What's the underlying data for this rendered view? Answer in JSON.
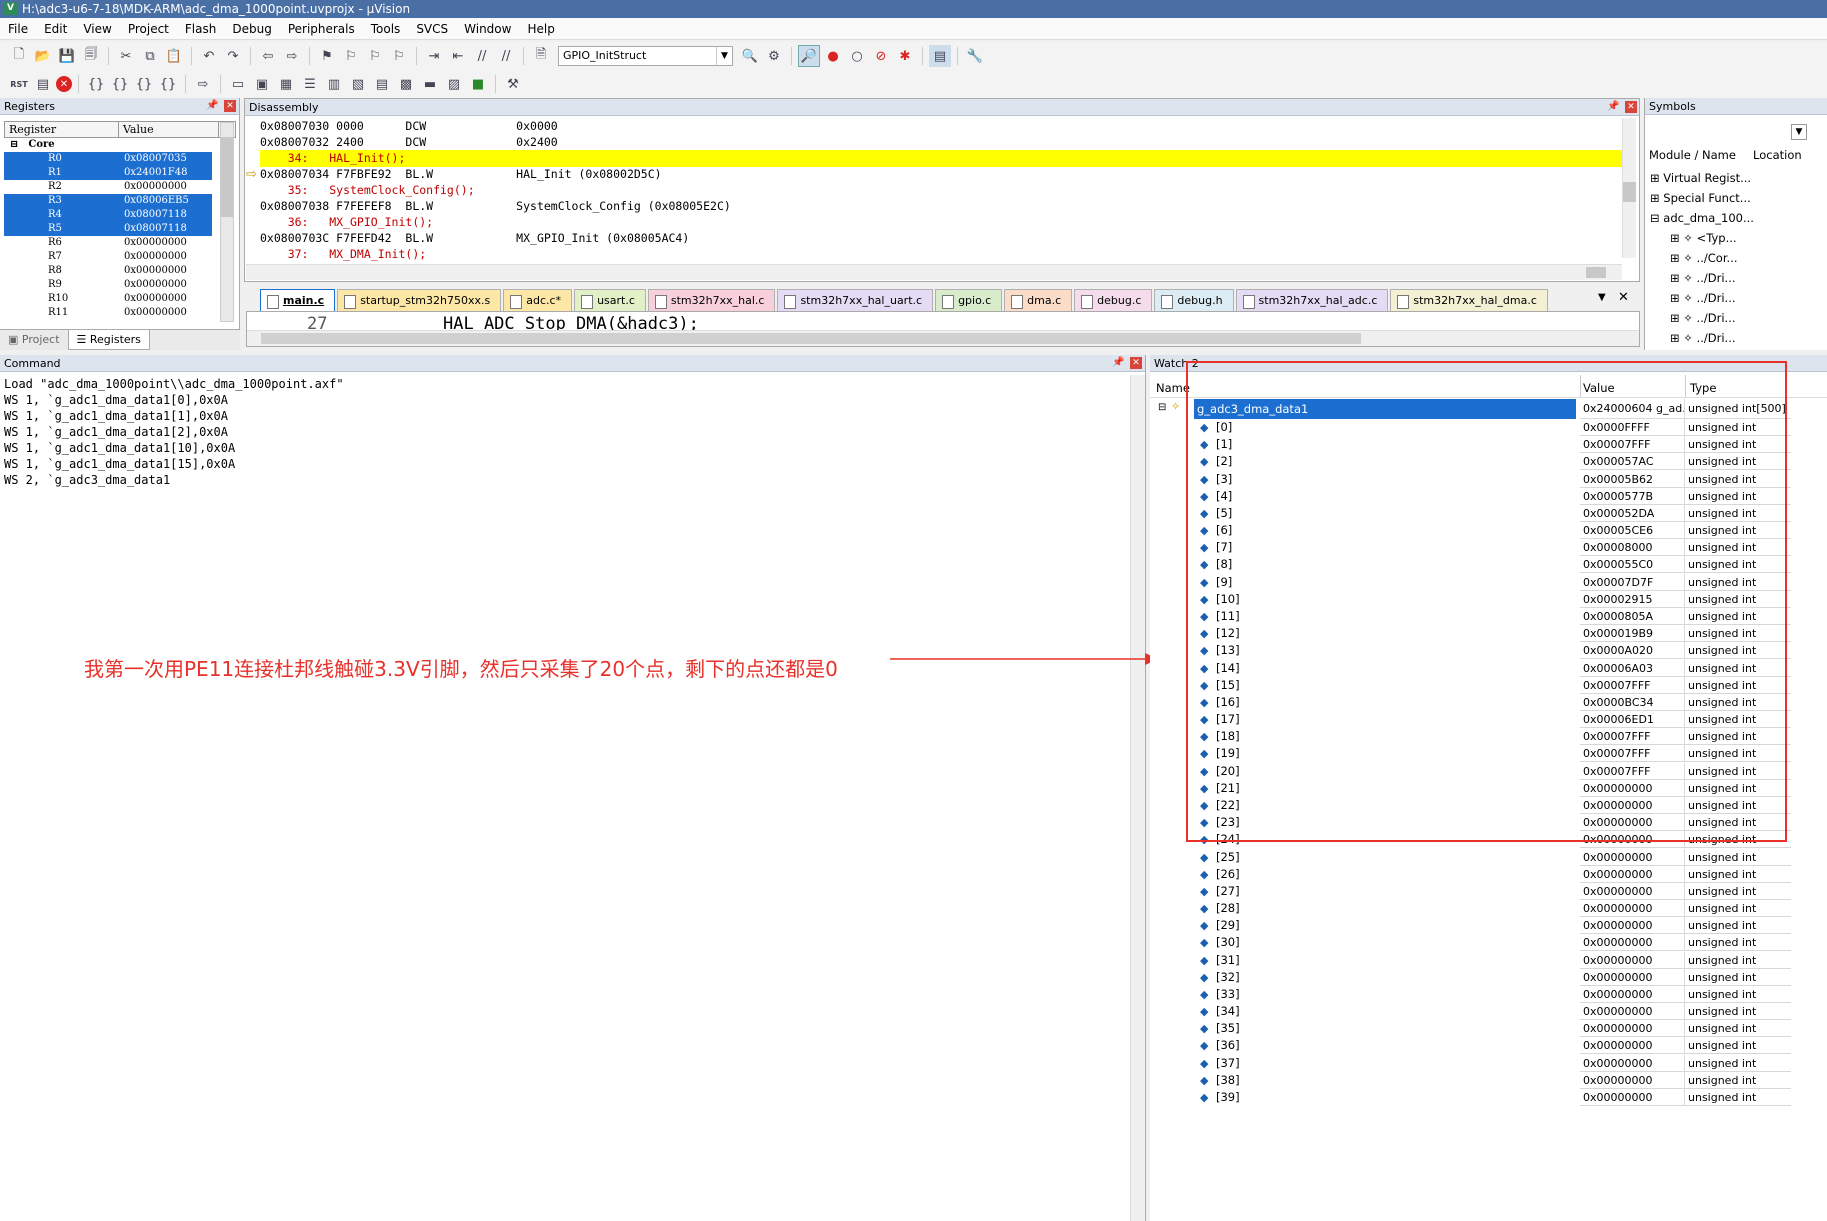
{
  "window": {
    "title": "H:\\adc3-u6-7-18\\MDK-ARM\\adc_dma_1000point.uvprojx - µVision",
    "logo": "V"
  },
  "menu": [
    "File",
    "Edit",
    "View",
    "Project",
    "Flash",
    "Debug",
    "Peripherals",
    "Tools",
    "SVCS",
    "Window",
    "Help"
  ],
  "toolbar": {
    "combo_value": "GPIO_InitStruct",
    "reset_label": "RST"
  },
  "registers": {
    "title": "Registers",
    "col_register": "Register",
    "col_value": "Value",
    "group": "Core",
    "rows": [
      {
        "name": "R0",
        "value": "0x08007035",
        "selected": true
      },
      {
        "name": "R1",
        "value": "0x24001F48",
        "selected": true
      },
      {
        "name": "R2",
        "value": "0x00000000",
        "selected": false
      },
      {
        "name": "R3",
        "value": "0x08006EB5",
        "selected": true
      },
      {
        "name": "R4",
        "value": "0x08007118",
        "selected": true
      },
      {
        "name": "R5",
        "value": "0x08007118",
        "selected": true
      },
      {
        "name": "R6",
        "value": "0x00000000",
        "selected": false
      },
      {
        "name": "R7",
        "value": "0x00000000",
        "selected": false
      },
      {
        "name": "R8",
        "value": "0x00000000",
        "selected": false
      },
      {
        "name": "R9",
        "value": "0x00000000",
        "selected": false
      },
      {
        "name": "R10",
        "value": "0x00000000",
        "selected": false
      },
      {
        "name": "R11",
        "value": "0x00000000",
        "selected": false
      }
    ],
    "tab_project": "Project",
    "tab_registers": "Registers"
  },
  "disassembly": {
    "title": "Disassembly",
    "lines": [
      {
        "text": "0x08007030 0000      DCW             0x0000",
        "kind": "asm"
      },
      {
        "text": "0x08007032 2400      DCW             0x2400",
        "kind": "asm"
      },
      {
        "text": "    34:   HAL_Init();",
        "kind": "src-current"
      },
      {
        "text": "0x08007034 F7FBFE92  BL.W            HAL_Init (0x08002D5C)",
        "kind": "asm-current"
      },
      {
        "text": "    35:   SystemClock_Config();",
        "kind": "src"
      },
      {
        "text": "0x08007038 F7FEFEF8  BL.W            SystemClock_Config (0x08005E2C)",
        "kind": "asm"
      },
      {
        "text": "    36:   MX_GPIO_Init();",
        "kind": "src"
      },
      {
        "text": "0x0800703C F7FEFD42  BL.W            MX_GPIO_Init (0x08005AC4)",
        "kind": "asm"
      },
      {
        "text": "    37:   MX_DMA_Init();",
        "kind": "src"
      }
    ]
  },
  "editor": {
    "tabs": [
      "main.c",
      "startup_stm32h750xx.s",
      "adc.c*",
      "usart.c",
      "stm32h7xx_hal.c",
      "stm32h7xx_hal_uart.c",
      "gpio.c",
      "dma.c",
      "debug.c",
      "debug.h",
      "stm32h7xx_hal_adc.c",
      "stm32h7xx_hal_dma.c"
    ],
    "active_tab": "main.c",
    "line_number": "27",
    "line_text": "HAL_ADC_Stop_DMA(&hadc3);"
  },
  "command": {
    "title": "Command",
    "lines": [
      "Load \"adc_dma_1000point\\\\adc_dma_1000point.axf\"",
      "WS 1, `g_adc1_dma_data1[0],0x0A",
      "WS 1, `g_adc1_dma_data1[1],0x0A",
      "WS 1, `g_adc1_dma_data1[2],0x0A",
      "WS 1, `g_adc1_dma_data1[10],0x0A",
      "WS 1, `g_adc1_dma_data1[15],0x0A",
      "WS 2, `g_adc3_dma_data1"
    ],
    "annotation": "我第一次用PE11连接杜邦线触碰3.3V引脚，然后只采集了20个点，剩下的点还都是0"
  },
  "watch": {
    "title": "Watch 2",
    "col_name": "Name",
    "col_value": "Value",
    "col_type": "Type",
    "root": {
      "name": "g_adc3_dma_data1",
      "value": "0x24000604 g_ad...",
      "type": "unsigned int[500]"
    },
    "items": [
      {
        "i": "[0]",
        "v": "0x0000FFFF"
      },
      {
        "i": "[1]",
        "v": "0x00007FFF"
      },
      {
        "i": "[2]",
        "v": "0x000057AC"
      },
      {
        "i": "[3]",
        "v": "0x00005B62"
      },
      {
        "i": "[4]",
        "v": "0x0000577B"
      },
      {
        "i": "[5]",
        "v": "0x000052DA"
      },
      {
        "i": "[6]",
        "v": "0x00005CE6"
      },
      {
        "i": "[7]",
        "v": "0x00008000"
      },
      {
        "i": "[8]",
        "v": "0x000055C0"
      },
      {
        "i": "[9]",
        "v": "0x00007D7F"
      },
      {
        "i": "[10]",
        "v": "0x00002915"
      },
      {
        "i": "[11]",
        "v": "0x0000805A"
      },
      {
        "i": "[12]",
        "v": "0x000019B9"
      },
      {
        "i": "[13]",
        "v": "0x0000A020"
      },
      {
        "i": "[14]",
        "v": "0x00006A03"
      },
      {
        "i": "[15]",
        "v": "0x00007FFF"
      },
      {
        "i": "[16]",
        "v": "0x0000BC34"
      },
      {
        "i": "[17]",
        "v": "0x00006ED1"
      },
      {
        "i": "[18]",
        "v": "0x00007FFF"
      },
      {
        "i": "[19]",
        "v": "0x00007FFF"
      },
      {
        "i": "[20]",
        "v": "0x00007FFF"
      },
      {
        "i": "[21]",
        "v": "0x00000000"
      },
      {
        "i": "[22]",
        "v": "0x00000000"
      },
      {
        "i": "[23]",
        "v": "0x00000000"
      },
      {
        "i": "[24]",
        "v": "0x00000000"
      },
      {
        "i": "[25]",
        "v": "0x00000000"
      },
      {
        "i": "[26]",
        "v": "0x00000000"
      },
      {
        "i": "[27]",
        "v": "0x00000000"
      },
      {
        "i": "[28]",
        "v": "0x00000000"
      },
      {
        "i": "[29]",
        "v": "0x00000000"
      },
      {
        "i": "[30]",
        "v": "0x00000000"
      },
      {
        "i": "[31]",
        "v": "0x00000000"
      },
      {
        "i": "[32]",
        "v": "0x00000000"
      },
      {
        "i": "[33]",
        "v": "0x00000000"
      },
      {
        "i": "[34]",
        "v": "0x00000000"
      },
      {
        "i": "[35]",
        "v": "0x00000000"
      },
      {
        "i": "[36]",
        "v": "0x00000000"
      },
      {
        "i": "[37]",
        "v": "0x00000000"
      },
      {
        "i": "[38]",
        "v": "0x00000000"
      },
      {
        "i": "[39]",
        "v": "0x00000000"
      }
    ],
    "item_type": "unsigned int"
  },
  "symbols": {
    "title": "Symbols",
    "col_module": "Module / Name",
    "col_location": "Location",
    "rows": [
      "Virtual Regist...",
      "Special Funct...",
      "adc_dma_100...",
      "<Typ...",
      "../Cor...",
      "../Dri...",
      "../Dri...",
      "../Dri...",
      "../Dri..."
    ]
  },
  "colors": {
    "highlight_yellow": "#ffff00",
    "selection_blue": "#1c6fd0",
    "annotation_red": "#e8312a"
  }
}
